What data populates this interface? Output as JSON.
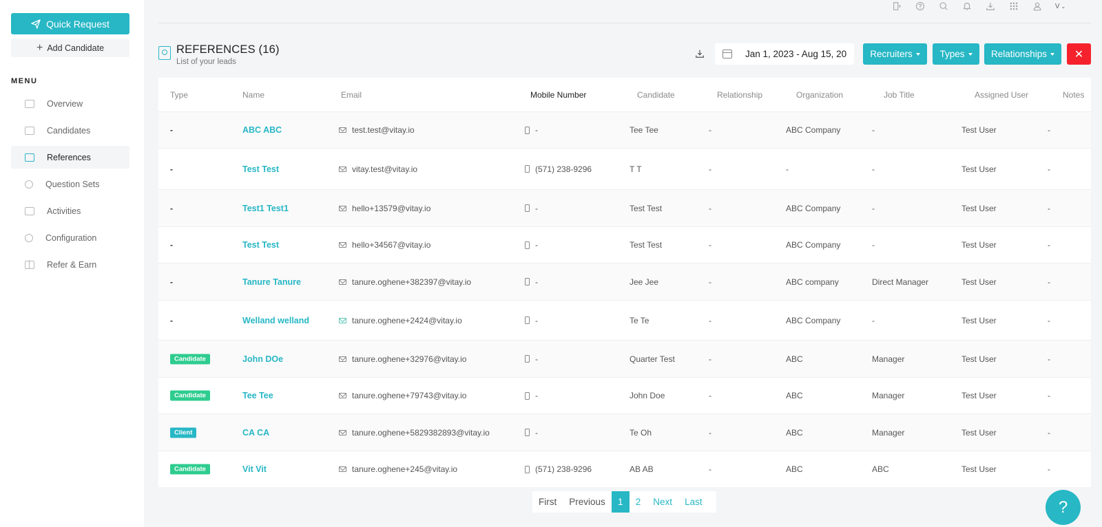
{
  "sidebar": {
    "quick_request": "Quick Request",
    "add_candidate": "Add Candidate",
    "menu_title": "MENU",
    "items": [
      {
        "label": "Overview"
      },
      {
        "label": "Candidates"
      },
      {
        "label": "References"
      },
      {
        "label": "Question Sets"
      },
      {
        "label": "Activities"
      },
      {
        "label": "Configuration"
      },
      {
        "label": "Refer & Earn"
      }
    ],
    "active_item": "References"
  },
  "topbar": {
    "user_initial": "V",
    "icons": [
      "logout-icon",
      "help-circle-icon",
      "search-icon",
      "bell-icon",
      "download-icon",
      "apps-grid-icon",
      "user-icon"
    ]
  },
  "header": {
    "title": "REFERENCES (16)",
    "subtitle": "List of your leads",
    "date_range": "Jan 1, 2023 - Aug 15, 20",
    "recruiters": "Recruiters",
    "types": "Types",
    "relationships": "Relationships",
    "close": "✕"
  },
  "table": {
    "columns": [
      "Type",
      "Name",
      "Email",
      "Mobile Number",
      "Candidate",
      "Relationship",
      "Organization",
      "Job Title",
      "Assigned User",
      "Notes"
    ],
    "rows": [
      {
        "type": "-",
        "name": "ABC ABC",
        "email": "test.test@vitay.io",
        "mobile": "-",
        "candidate": "Tee Tee",
        "relationship": "-",
        "organization": "ABC Company",
        "job_title": "-",
        "assigned_user": "Test User",
        "notes": "-"
      },
      {
        "type": "-",
        "name": "Test Test",
        "email": "vitay.test@vitay.io",
        "mobile": "(571) 238-9296",
        "candidate": "T T",
        "relationship": "-",
        "organization": "-",
        "job_title": "-",
        "assigned_user": "Test User",
        "notes": "-"
      },
      {
        "type": "-",
        "name": "Test1 Test1",
        "email": "hello+13579@vitay.io",
        "mobile": "-",
        "candidate": "Test Test",
        "relationship": "-",
        "organization": "ABC Company",
        "job_title": "-",
        "assigned_user": "Test User",
        "notes": "-"
      },
      {
        "type": "-",
        "name": "Test Test",
        "email": "hello+34567@vitay.io",
        "mobile": "-",
        "candidate": "Test Test",
        "relationship": "-",
        "organization": "ABC Company",
        "job_title": "-",
        "assigned_user": "Test User",
        "notes": "-"
      },
      {
        "type": "-",
        "name": "Tanure Tanure",
        "email": "tanure.oghene+382397@vitay.io",
        "mobile": "-",
        "candidate": "Jee Jee",
        "relationship": "-",
        "organization": "ABC company",
        "job_title": "Direct Manager",
        "assigned_user": "Test User",
        "notes": "-"
      },
      {
        "type": "-",
        "name": "Welland welland",
        "email": "tanure.oghene+2424@vitay.io",
        "mobile": "-",
        "candidate": "Te Te",
        "relationship": "-",
        "organization": "ABC Company",
        "job_title": "-",
        "assigned_user": "Test User",
        "notes": "-",
        "email_opened": true
      },
      {
        "type": "Candidate",
        "name": "John DOe",
        "email": "tanure.oghene+32976@vitay.io",
        "mobile": "-",
        "candidate": "Quarter Test",
        "relationship": "-",
        "organization": "ABC",
        "job_title": "Manager",
        "assigned_user": "Test User",
        "notes": "-"
      },
      {
        "type": "Candidate",
        "name": "Tee Tee",
        "email": "tanure.oghene+79743@vitay.io",
        "mobile": "-",
        "candidate": "John Doe",
        "relationship": "-",
        "organization": "ABC",
        "job_title": "Manager",
        "assigned_user": "Test User",
        "notes": "-"
      },
      {
        "type": "Client",
        "name": "CA CA",
        "email": "tanure.oghene+5829382893@vitay.io",
        "mobile": "-",
        "candidate": "Te Oh",
        "relationship": "-",
        "organization": "ABC",
        "job_title": "Manager",
        "assigned_user": "Test User",
        "notes": "-"
      },
      {
        "type": "Candidate",
        "name": "Vit Vit",
        "email": "tanure.oghene+245@vitay.io",
        "mobile": "(571) 238-9296",
        "candidate": "AB AB",
        "relationship": "-",
        "organization": "ABC",
        "job_title": "ABC",
        "assigned_user": "Test User",
        "notes": "-"
      }
    ]
  },
  "pagination": {
    "first": "First",
    "previous": "Previous",
    "pages": [
      "1",
      "2"
    ],
    "current": "1",
    "next": "Next",
    "last": "Last"
  },
  "help": {
    "label": "?"
  },
  "colors": {
    "accent": "#27b7c5",
    "danger": "#f5222d",
    "candidate_badge": "#2ecc8f",
    "client_badge": "#27b7c5"
  }
}
